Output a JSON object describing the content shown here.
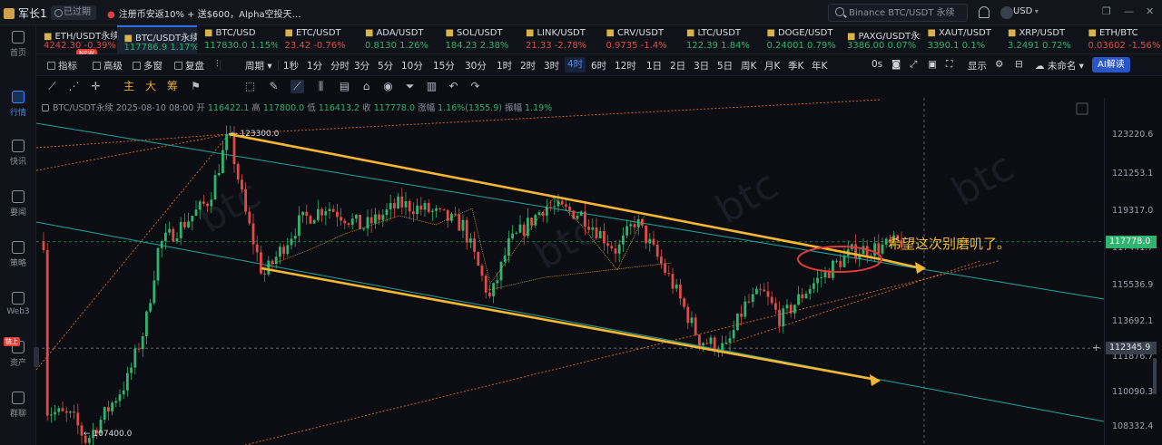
{
  "topbar": {
    "user": "军长1",
    "expired": "已过期",
    "promo": "注册币安返10% + 送$600，Alpha空投天…",
    "search_placeholder": "Binance BTC/USDT 永续",
    "currency": "USD"
  },
  "tickers": [
    {
      "name": "ETH/USDT永续",
      "price": "4242.30",
      "change": "-0.39%",
      "dir": "dn"
    },
    {
      "name": "BTC/USDT永续",
      "price": "117786.9",
      "change": "1.17%",
      "dir": "up",
      "active": true
    },
    {
      "name": "BTC/USD",
      "price": "117830.0",
      "change": "1.15%",
      "dir": "up"
    },
    {
      "name": "ETC/USDT",
      "price": "23.42",
      "change": "-0.76%",
      "dir": "dn"
    },
    {
      "name": "ADA/USDT",
      "price": "0.8130",
      "change": "1.26%",
      "dir": "up"
    },
    {
      "name": "SOL/USDT",
      "price": "184.23",
      "change": "2.38%",
      "dir": "up"
    },
    {
      "name": "LINK/USDT",
      "price": "21.33",
      "change": "-2.78%",
      "dir": "dn"
    },
    {
      "name": "CRV/USDT",
      "price": "0.9735",
      "change": "-1.4%",
      "dir": "dn"
    },
    {
      "name": "LTC/USDT",
      "price": "122.39",
      "change": "1.84%",
      "dir": "up"
    },
    {
      "name": "DOGE/USDT",
      "price": "0.24001",
      "change": "0.79%",
      "dir": "up"
    },
    {
      "name": "PAXG/USDT永续",
      "price": "3386.00",
      "change": "0.07%",
      "dir": "up"
    },
    {
      "name": "XAUT/USDT",
      "price": "3390.1",
      "change": "0.1%",
      "dir": "up"
    },
    {
      "name": "XRP/USDT",
      "price": "3.2491",
      "change": "0.72%",
      "dir": "up"
    },
    {
      "name": "ETH/BTC",
      "price": "0.03602",
      "change": "-1.56%",
      "dir": "dn"
    }
  ],
  "new_tag": "NEW",
  "sidebar": [
    {
      "label": "首页",
      "icon": "home-icon"
    },
    {
      "label": "行情",
      "icon": "chart-icon",
      "active": true
    },
    {
      "label": "快讯",
      "icon": "news-icon"
    },
    {
      "label": "要闻",
      "icon": "article-icon"
    },
    {
      "label": "策略",
      "icon": "strategy-icon"
    },
    {
      "label": "Web3",
      "icon": "web3-icon"
    },
    {
      "label": "资产",
      "icon": "wallet-icon",
      "tag": "链上"
    },
    {
      "label": "群聊",
      "icon": "chat-icon"
    }
  ],
  "toolbar": {
    "indicators": "指标",
    "advanced": "高级",
    "multi": "多窗",
    "replay": "复盘",
    "period": "周期",
    "intervals": [
      "1秒",
      "1分",
      "分时",
      "3分",
      "5分",
      "10分",
      "15分",
      "30分",
      "1时",
      "2时",
      "3时",
      "4时",
      "6时",
      "12时",
      "1日",
      "2日",
      "3日",
      "5日",
      "周K",
      "月K",
      "季K",
      "年K"
    ],
    "selected_interval": "4时",
    "countdown": "0s",
    "display": "显示",
    "unnamed": "未命名",
    "ai": "AI解读"
  },
  "draw_tools": {
    "main": "主",
    "big": "大",
    "chips": "筹"
  },
  "legend": {
    "symbol": "BTC/USDT永续",
    "time": "2025-08-10 08:00",
    "open_label": "开",
    "open": "116422.1",
    "high_label": "高",
    "high": "117800.0",
    "low_label": "低",
    "low": "116413.2",
    "close_label": "收",
    "close": "117778.0",
    "change_label": "涨幅",
    "change": "1.16%(1355.9)",
    "amp_label": "振幅",
    "amp": "1.19%"
  },
  "chart_data": {
    "type": "candlestick",
    "y_ticks": [
      "123220.6",
      "121253.1",
      "119317.0",
      "117441.7",
      "115536.9",
      "113692.1",
      "111876.7",
      "110090.3",
      "108332.4"
    ],
    "price_tags": {
      "last": "117778.0",
      "crosshair": "112345.9"
    },
    "high_marker": "123300.0",
    "low_marker": "107400.0",
    "annotation": "希望这次别磨叽了。",
    "watermark": "btc",
    "colors": {
      "up": "#2fb36e",
      "down": "#e04a47",
      "channel": "#f5b731",
      "fib": "#d86b2a",
      "trend": "#1aa7a0"
    }
  }
}
